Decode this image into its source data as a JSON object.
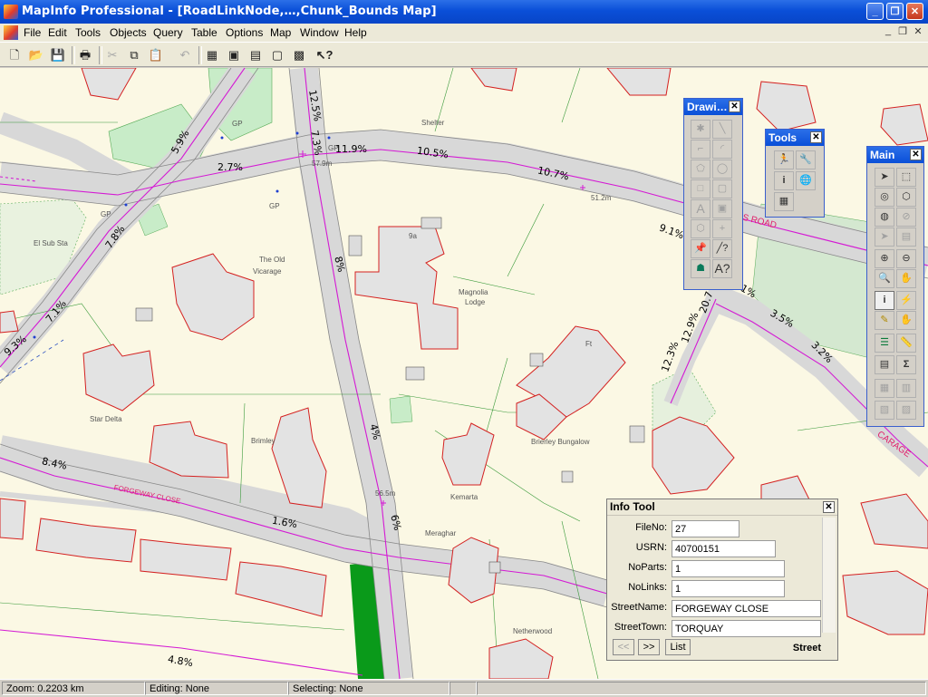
{
  "window": {
    "title": "MapInfo Professional - [RoadLinkNode,…,Chunk_Bounds Map]"
  },
  "menu": [
    "File",
    "Edit",
    "Tools",
    "Objects",
    "Query",
    "Table",
    "Options",
    "Map",
    "Window",
    "Help"
  ],
  "toolbar_icons": [
    "new-document-icon",
    "open-folder-icon",
    "save-icon",
    "print-icon",
    "cut-icon",
    "copy-icon",
    "paste-icon",
    "undo-icon",
    "new-browser-icon",
    "new-mapper-icon",
    "new-grapher-icon",
    "new-layout-icon",
    "redistrict-icon",
    "help-pointer-icon"
  ],
  "map": {
    "labels": [
      {
        "text": "Shelter"
      },
      {
        "text": "GP"
      },
      {
        "text": "GP"
      },
      {
        "text": "GP"
      },
      {
        "text": "GP"
      },
      {
        "text": "El Sub Sta"
      },
      {
        "text": "The Old"
      },
      {
        "text": "Vicarage"
      },
      {
        "text": "Magnolia"
      },
      {
        "text": "Lodge"
      },
      {
        "text": "Star Delta"
      },
      {
        "text": "Brimley"
      },
      {
        "text": "Brierley Bungalow"
      },
      {
        "text": "Kemarta"
      },
      {
        "text": "Meraghar"
      },
      {
        "text": "Netherwood"
      },
      {
        "text": "9a"
      },
      {
        "text": "Ft"
      },
      {
        "text": "57.9m"
      },
      {
        "text": "51.2m"
      },
      {
        "text": "56.5m"
      }
    ],
    "gradients": [
      "5.9%",
      "2.7%",
      "12.5%",
      "7.3%",
      "11.9%",
      "10.5%",
      "10.7%",
      "9.1%",
      "7.8%",
      "7.1%",
      "9.3%",
      "8%",
      "4%",
      "6%",
      "8.4%",
      "1.6%",
      "4.8%",
      "12.3%",
      "12.9%",
      "20.7",
      "3.5%",
      "3.2%",
      "1%"
    ],
    "road_names": [
      "'S ROAD",
      "CARAGE",
      "FORGEWAY CLOSE"
    ]
  },
  "drawing_palette": {
    "title": "Drawi…"
  },
  "tools_palette": {
    "title": "Tools"
  },
  "main_palette": {
    "title": "Main"
  },
  "info_tool": {
    "title": "Info Tool",
    "fields": [
      {
        "label": "FileNo:",
        "value": "27"
      },
      {
        "label": "USRN:",
        "value": "40700151"
      },
      {
        "label": "NoParts:",
        "value": "1"
      },
      {
        "label": "NoLinks:",
        "value": "1"
      },
      {
        "label": "StreetName:",
        "value": "FORGEWAY CLOSE"
      },
      {
        "label": "StreetTown:",
        "value": "TORQUAY"
      }
    ],
    "prev_label": "<<",
    "next_label": ">>",
    "list_label": "List",
    "layer_name": "Street"
  },
  "status": {
    "zoom": "Zoom: 0.2203 km",
    "editing": "Editing: None",
    "selecting": "Selecting: None"
  }
}
